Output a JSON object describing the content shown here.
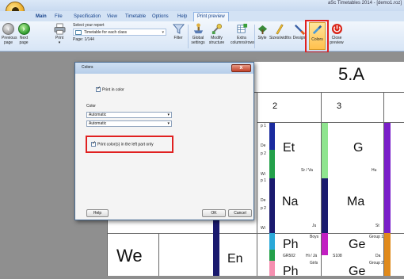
{
  "window": {
    "title": "aSc Timetables 2014 - [demo1.roz]"
  },
  "tabs": [
    {
      "label": "Main"
    },
    {
      "label": "File"
    },
    {
      "label": "Specification"
    },
    {
      "label": "View"
    },
    {
      "label": "Timetable"
    },
    {
      "label": "Options"
    },
    {
      "label": "Help"
    },
    {
      "label": "Print preview"
    }
  ],
  "ribbon": {
    "previous_page": "Previous page",
    "next_page": "Next page",
    "print": "Print",
    "select_report_label": "Select your report",
    "report_value": "Timetable for each class",
    "page_text": "Page: 1/144",
    "filter": "Filter",
    "global_settings": "Global settings",
    "modify_structure": "Modify structure",
    "extra_columns": "Extra columns/rows",
    "style": "Style",
    "sizes_widths": "Sizes/widths",
    "design": "Design",
    "colors": "Colors",
    "close_preview": "Close preview"
  },
  "preview": {
    "class_name": "5.A",
    "col_2": "2",
    "col_3": "3",
    "row_p1": "p 1",
    "row_de": "De",
    "row_p2": "p 2",
    "row_wi": "Wi",
    "row_p1b": "p 1",
    "row_deb": "De",
    "row_p2b": "p 2",
    "row_wib": "Wi",
    "day_we": "We",
    "subj_en": "En",
    "cell_et": "Et",
    "cell_et_sub": "Sr / Va",
    "cell_g": "G",
    "cell_g_sub": "Hu",
    "cell_na": "Na",
    "cell_na_sub": "Ju",
    "cell_ma": "Ma",
    "cell_ma_sub": "St",
    "cell_ph": "Ph",
    "cell_ph_group": "Boys",
    "cell_ph_sub": "GR502",
    "cell_ph_teacher": "Hi / Já",
    "cell_ge": "Ge",
    "cell_ge_group": "Group 1",
    "cell_ge_room": "S108",
    "cell_ge_teacher": "Da",
    "cell_ph2_group": "Girls",
    "cell_ge2_group": "Group 2"
  },
  "dialog": {
    "title": "Colors",
    "print_in_color": "Print in color",
    "color_label": "Color",
    "combo1": "Automatic",
    "combo2": "Automatic",
    "print_left_only": "Print color(s) in the left part only",
    "help": "Help",
    "ok": "OK",
    "cancel": "Cancel",
    "close_glyph": "x"
  },
  "colors": {
    "accent_highlight": "#e02020",
    "dark_navy": "#1a1a6e",
    "light_green": "#8fe58f",
    "purple": "#7a1fc9",
    "cyan": "#2aa8d8",
    "green": "#23a04a",
    "pink": "#f58fb0",
    "magenta": "#c21fc2",
    "blue_dark": "#1a2b9e",
    "orange": "#e08a1c"
  }
}
